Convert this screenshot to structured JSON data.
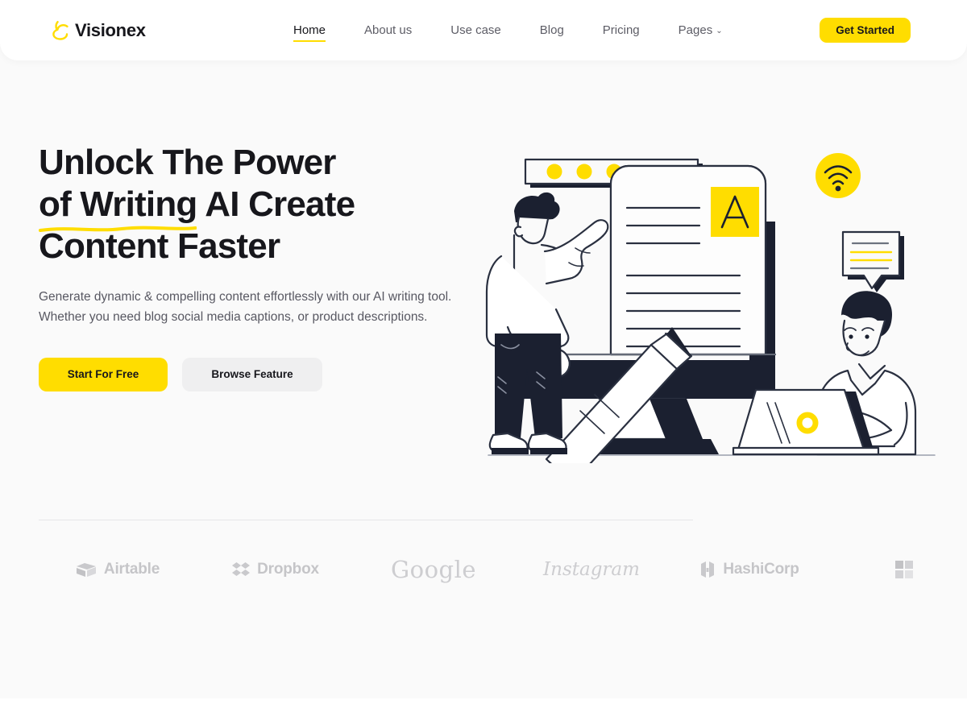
{
  "brand": {
    "name": "Visionex",
    "mark_icon": "cloud-swoosh-icon"
  },
  "nav": {
    "items": [
      {
        "label": "Home",
        "active": true,
        "has_chevron": false
      },
      {
        "label": "About us",
        "active": false,
        "has_chevron": false
      },
      {
        "label": "Use case",
        "active": false,
        "has_chevron": false
      },
      {
        "label": "Blog",
        "active": false,
        "has_chevron": false
      },
      {
        "label": "Pricing",
        "active": false,
        "has_chevron": false
      },
      {
        "label": "Pages",
        "active": false,
        "has_chevron": true
      }
    ],
    "chevron_glyph": "⌄",
    "cta_label": "Get Started"
  },
  "hero": {
    "title_line1": "Unlock The Power",
    "title_line2_underlined": "of Writing",
    "title_line2_rest": " AI Create",
    "title_line3": "Content Faster",
    "subtitle": "Generate dynamic & compelling content effortlessly with our AI writing tool. Whether you need blog social media captions, or product descriptions.",
    "primary_button": "Start For Free",
    "secondary_button": "Browse Feature",
    "illustration": {
      "name": "ai-writing-illustration",
      "elements": [
        "speech-bubble-dots",
        "person-pointing",
        "giant-pencil",
        "desktop-monitor-document",
        "letter-A-tile",
        "wifi-badge",
        "speech-bubble-lines",
        "person-with-laptop",
        "laptop"
      ],
      "letter_tile": "A"
    }
  },
  "logos": {
    "items": [
      {
        "name": "Airtable",
        "icon": "airtable-icon"
      },
      {
        "name": "Dropbox",
        "icon": "dropbox-icon"
      },
      {
        "name": "Google",
        "icon": "none"
      },
      {
        "name": "Instagram",
        "icon": "none"
      },
      {
        "name": "HashiCorp",
        "icon": "hashicorp-icon"
      },
      {
        "name": "",
        "icon": "microsoft-icon"
      }
    ]
  },
  "colors": {
    "accent_yellow": "#FFDD00",
    "ink": "#17171C",
    "illustration_dark": "#1B2030",
    "page_background": "#FAFAFA",
    "muted_text": "#585862",
    "logo_gray": "#C5C5C8"
  }
}
